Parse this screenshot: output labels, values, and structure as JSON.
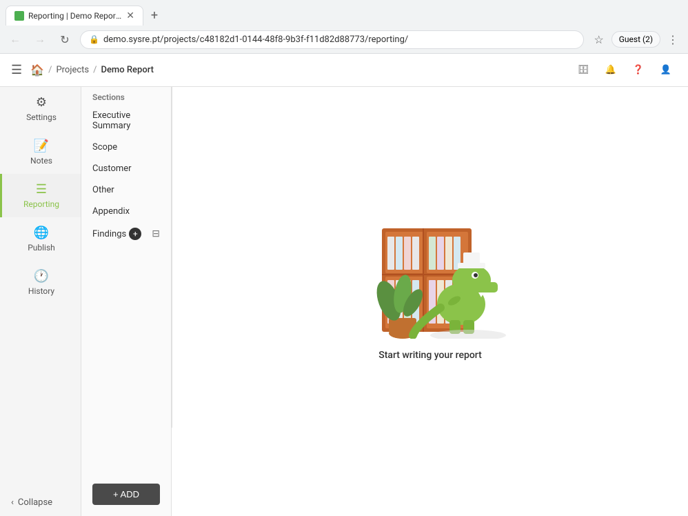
{
  "browser": {
    "tab_title": "Reporting | Demo Report | S...",
    "url": "demo.sysre.pt/projects/c48182d1-0144-48f8-9b3f-f11d82d88773/reporting/",
    "new_tab_label": "+",
    "back_btn": "←",
    "forward_btn": "→",
    "refresh_btn": "↻",
    "guest_label": "Guest (2)",
    "more_options": "⋮"
  },
  "header": {
    "home_icon": "🏠",
    "breadcrumb": [
      "Projects",
      "Demo Report"
    ],
    "icons": {
      "archive": "🗄",
      "bell": "🔔",
      "help": "❓",
      "user": "👤"
    }
  },
  "sidebar": {
    "items": [
      {
        "id": "settings",
        "label": "Settings",
        "icon": "⚙"
      },
      {
        "id": "notes",
        "label": "Notes",
        "icon": "📝"
      },
      {
        "id": "reporting",
        "label": "Reporting",
        "icon": "☰",
        "active": true
      },
      {
        "id": "publish",
        "label": "Publish",
        "icon": "🌐"
      },
      {
        "id": "history",
        "label": "History",
        "icon": "🕐"
      }
    ],
    "collapse_label": "Collapse"
  },
  "secondary_sidebar": {
    "sections_header": "Sections",
    "items": [
      {
        "id": "executive-summary",
        "label": "Executive Summary"
      },
      {
        "id": "scope",
        "label": "Scope"
      },
      {
        "id": "customer",
        "label": "Customer"
      },
      {
        "id": "other",
        "label": "Other"
      },
      {
        "id": "appendix",
        "label": "Appendix"
      }
    ],
    "findings_label": "Findings",
    "add_finding_tooltip": "+",
    "add_btn_label": "+ ADD"
  },
  "main": {
    "empty_state_text": "Start writing your report"
  }
}
